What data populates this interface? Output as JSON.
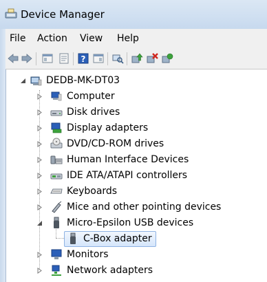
{
  "window": {
    "title": "Device Manager",
    "title_icon": "device-manager-icon"
  },
  "menu": {
    "items": [
      "File",
      "Action",
      "View",
      "Help"
    ]
  },
  "toolbar": {
    "buttons": [
      "back-arrow-icon",
      "forward-arrow-icon",
      "console-tree-icon",
      "properties-icon",
      "help-icon",
      "action-pane-icon",
      "scan-hardware-icon",
      "update-driver-icon",
      "uninstall-icon",
      "enable-device-icon"
    ]
  },
  "tree": {
    "root": "DEDB-MK-DT03",
    "categories": [
      {
        "label": "Computer",
        "icon": "computer-icon",
        "expanded": false
      },
      {
        "label": "Disk drives",
        "icon": "disk-drive-icon",
        "expanded": false
      },
      {
        "label": "Display adapters",
        "icon": "display-adapter-icon",
        "expanded": false
      },
      {
        "label": "DVD/CD-ROM drives",
        "icon": "dvd-drive-icon",
        "expanded": false
      },
      {
        "label": "Human Interface Devices",
        "icon": "hid-icon",
        "expanded": false
      },
      {
        "label": "IDE ATA/ATAPI controllers",
        "icon": "ide-controller-icon",
        "expanded": false
      },
      {
        "label": "Keyboards",
        "icon": "keyboard-icon",
        "expanded": false
      },
      {
        "label": "Mice and other pointing devices",
        "icon": "mouse-icon",
        "expanded": false
      },
      {
        "label": "Micro-Epsilon USB devices",
        "icon": "usb-device-icon",
        "expanded": true
      },
      {
        "label": "Monitors",
        "icon": "monitor-icon",
        "expanded": false
      },
      {
        "label": "Network adapters",
        "icon": "network-adapter-icon",
        "expanded": false
      }
    ],
    "child": {
      "label": "C-Box adapter",
      "icon": "usb-plug-icon",
      "selected": true
    }
  },
  "colors": {
    "selection_border": "#8db2e3",
    "title_gradient": "#cfdff1",
    "menubar": "#f0f0f0"
  }
}
